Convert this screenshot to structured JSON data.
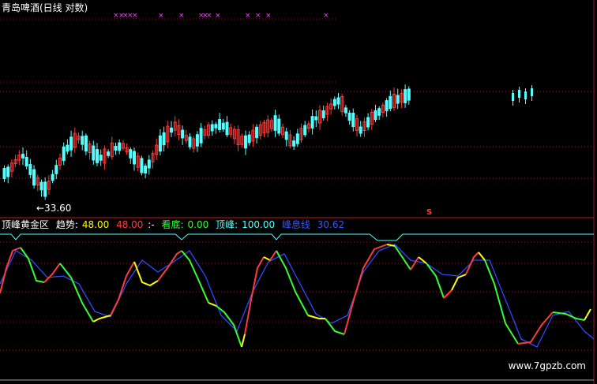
{
  "window": {
    "title": "青岛啤酒(日线 对数)"
  },
  "price_panel": {
    "low_label": "←33.60",
    "signal_marker": "S",
    "colors": {
      "up": "#ff3b3b",
      "down": "#54ffff",
      "marker": "#ff33ff",
      "grid": "#8b1a1a"
    }
  },
  "indicator_panel": {
    "name": "顶峰黄金区",
    "fields": [
      {
        "label": "趋势:",
        "value": "48.00",
        "color": "#ffff00"
      },
      {
        "label": "",
        "value": "48.00",
        "color": "#ff3b3b"
      },
      {
        "label": ":-",
        "value": "",
        "color": "#ffffff"
      },
      {
        "label": "看底:",
        "value": "0.00",
        "color": "#33ff33"
      },
      {
        "label": "顶峰:",
        "value": "100.00",
        "color": "#54ffff"
      },
      {
        "label": "峰息线",
        "value": "30.62",
        "color": "#3355ff"
      }
    ]
  },
  "watermark": "www.7gpzb.com"
}
